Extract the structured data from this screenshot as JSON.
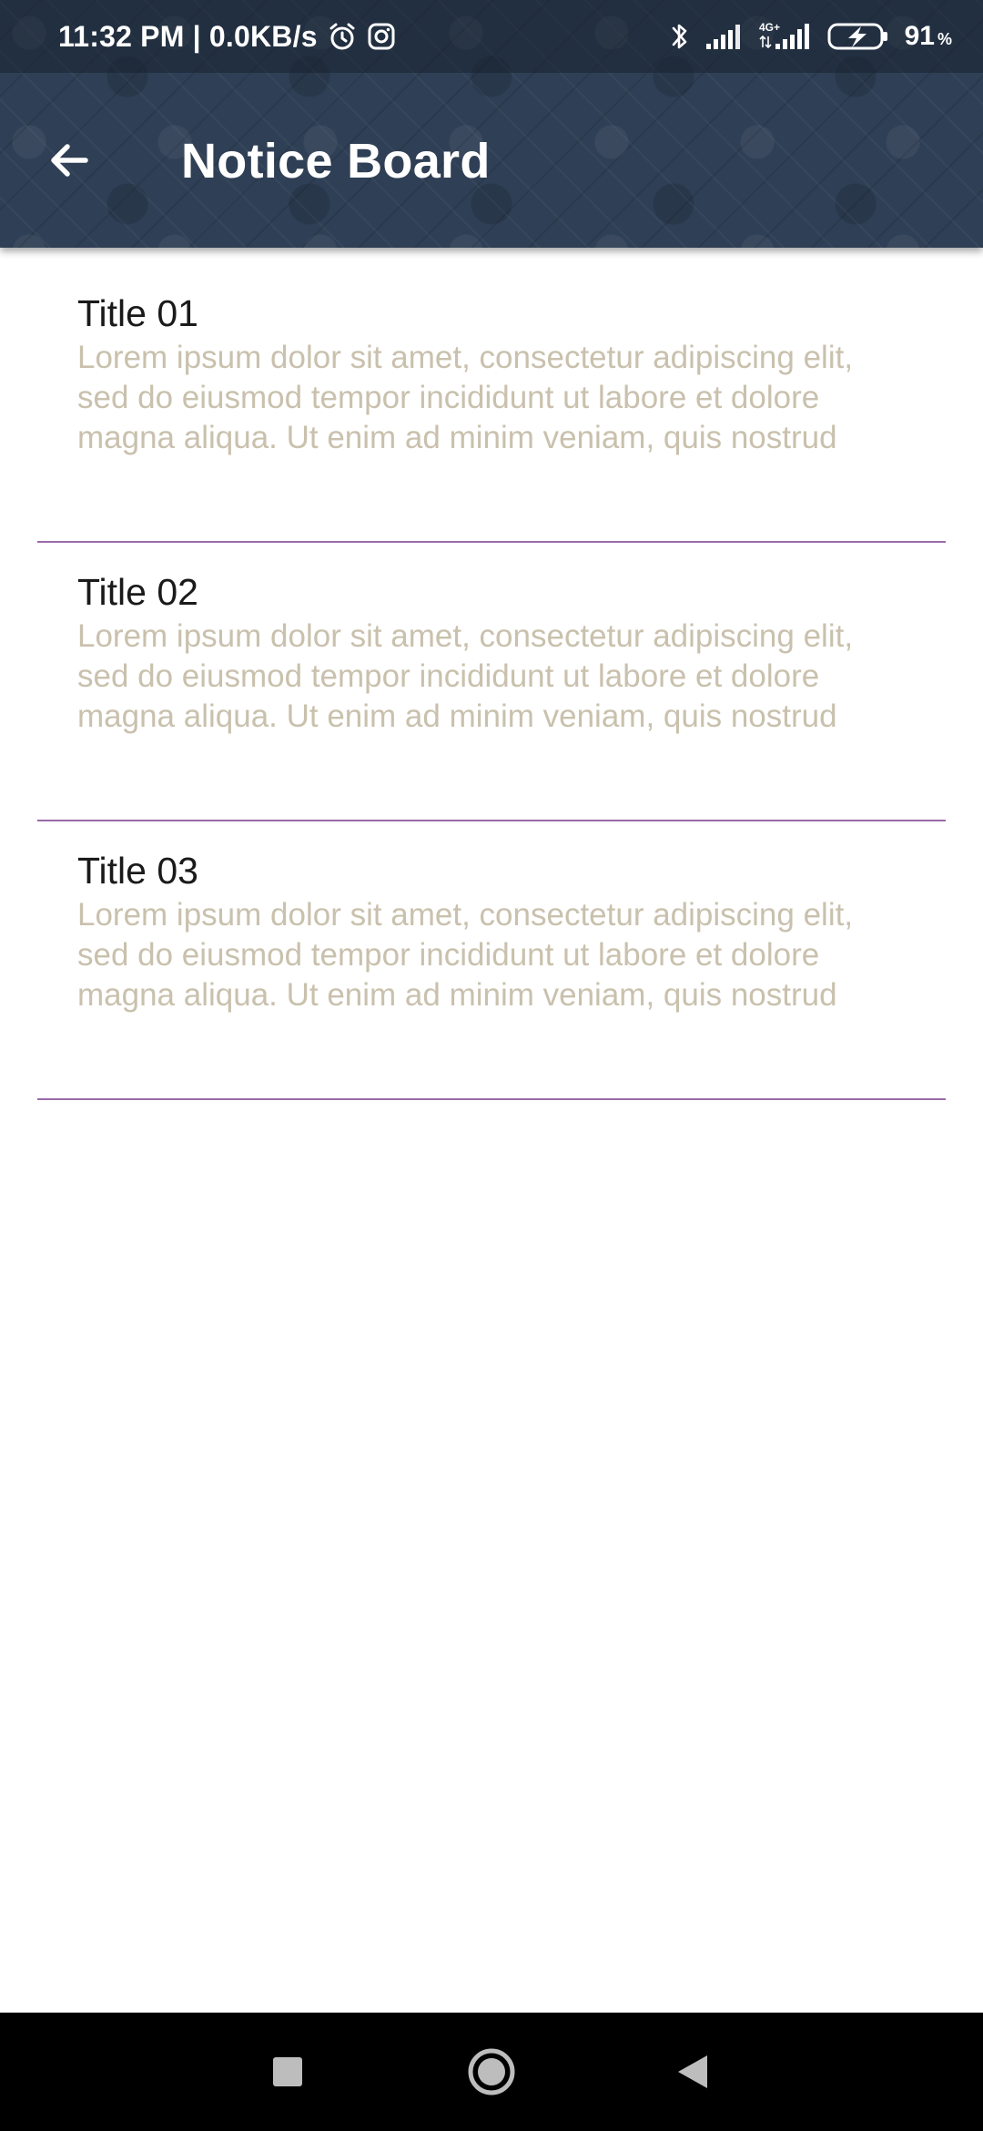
{
  "status_bar": {
    "time": "11:32 PM | 0.0KB/s",
    "battery_percent": "91",
    "battery_unit": "%",
    "network_label": "4G+",
    "icons": [
      "alarm-icon",
      "instagram-icon",
      "bluetooth-icon",
      "signal-icon",
      "signal-4g-icon",
      "battery-charging-icon"
    ]
  },
  "app_bar": {
    "title": "Notice Board",
    "back_icon": "arrow-back-icon",
    "background_color": "#2f3f55"
  },
  "notices": [
    {
      "title": "Title 01",
      "body": "Lorem ipsum dolor sit amet, consectetur adipiscing elit, sed do eiusmod tempor incididunt ut labore et dolore magna aliqua. Ut enim ad minim veniam, quis nostrud"
    },
    {
      "title": "Title 02",
      "body": "Lorem ipsum dolor sit amet, consectetur adipiscing elit, sed do eiusmod tempor incididunt ut labore et dolore magna aliqua. Ut enim ad minim veniam, quis nostrud"
    },
    {
      "title": "Title 03",
      "body": "Lorem ipsum dolor sit amet, consectetur adipiscing elit, sed do eiusmod tempor incididunt ut labore et dolore magna aliqua. Ut enim ad minim veniam, quis nostrud"
    }
  ],
  "colors": {
    "divider": "#9a6aa8",
    "title_text": "#1a1a1a",
    "body_text": "#c9c1ad"
  },
  "nav_bar": {
    "buttons": [
      "recent-apps-icon",
      "home-icon",
      "back-icon"
    ]
  }
}
